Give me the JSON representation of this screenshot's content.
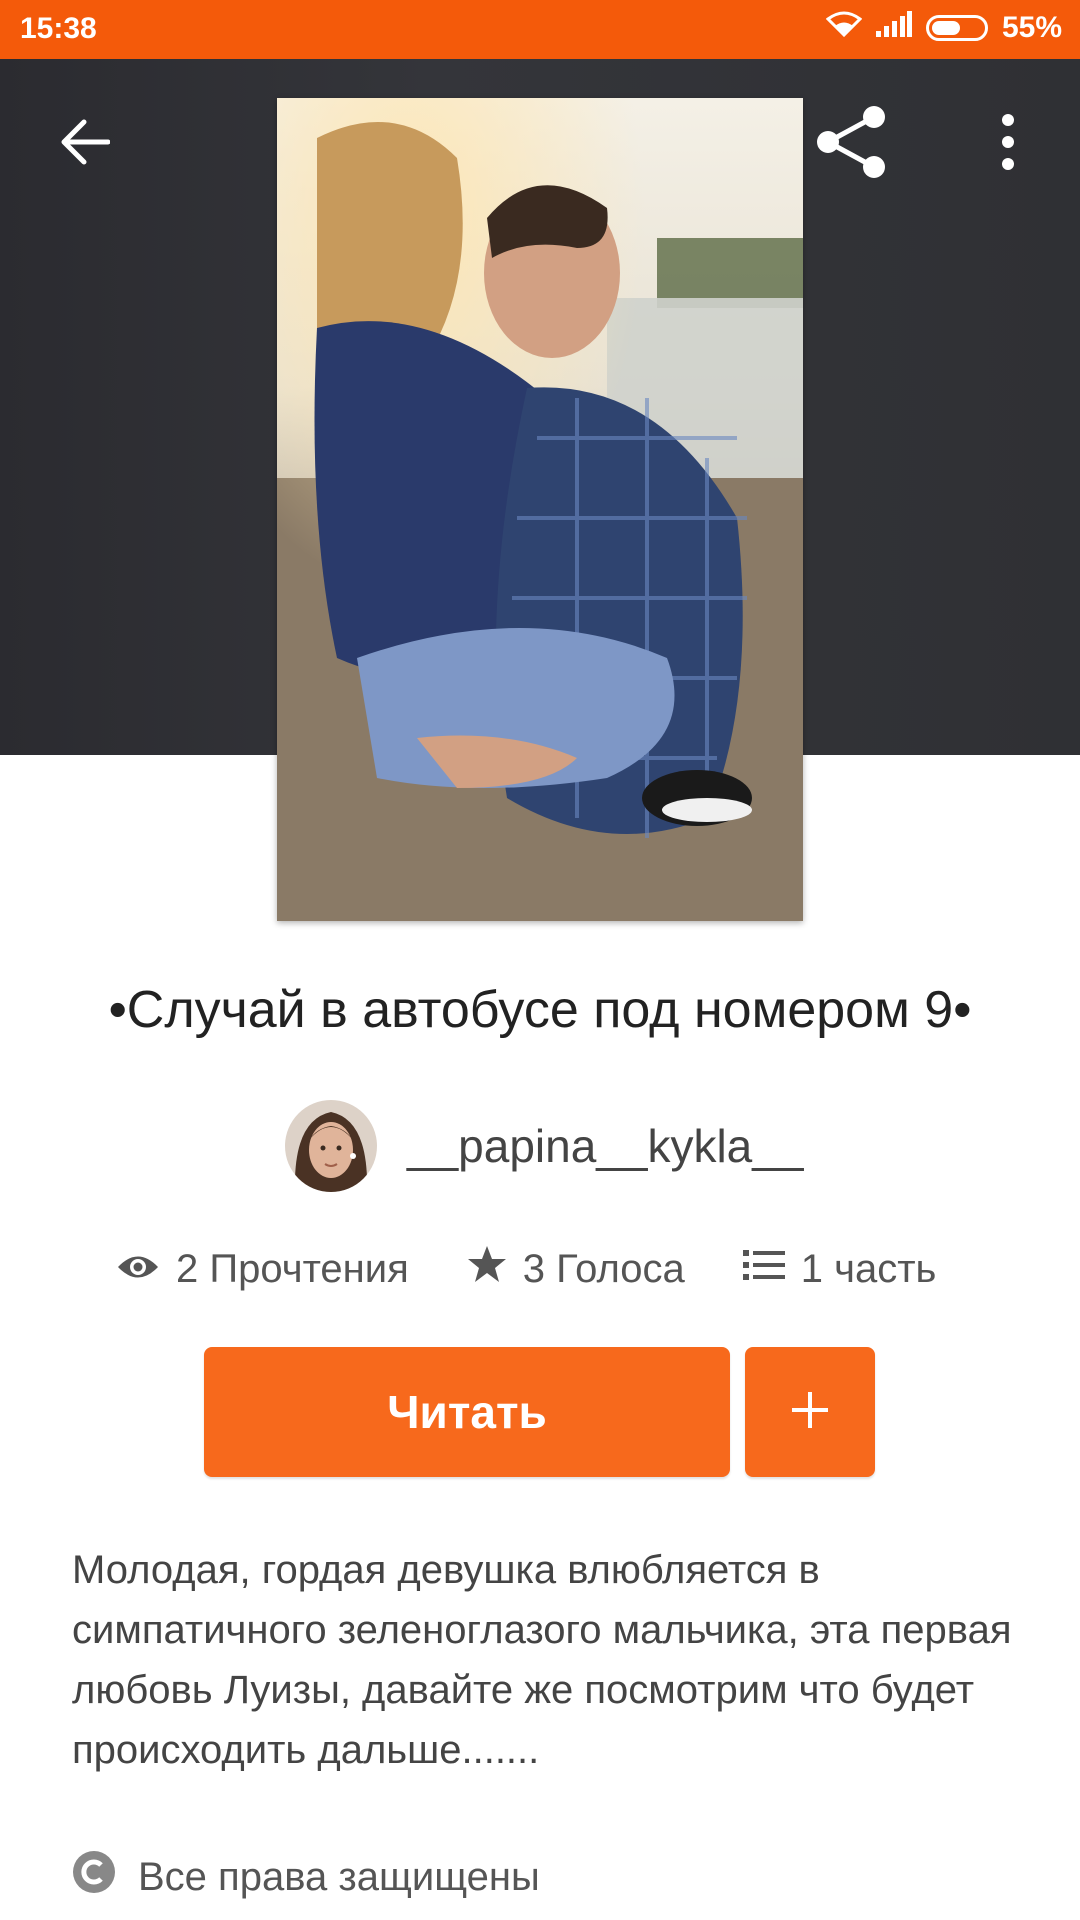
{
  "status_bar": {
    "time": "15:38",
    "battery": "55%",
    "battery_level": 0.55,
    "icons": [
      "wifi-icon",
      "signal-icon",
      "battery-icon"
    ]
  },
  "toolbar": {
    "back_icon": "arrow-left-icon",
    "share_icon": "share-icon",
    "more_icon": "more-vertical-icon"
  },
  "story": {
    "title": "•Случай в автобусе под номером 9•",
    "author": "__papina__kykla__",
    "stats": {
      "reads": "2 Прочтения",
      "votes": "3 Голоса",
      "parts": "1 часть"
    },
    "read_button": "Читать",
    "add_button": "+",
    "description": "Молодая, гордая девушка влюбляется в симпатичного зеленоглазого мальчика, эта первая любовь Луизы, давайте же посмотрим что будет происходить дальше.......",
    "rights": "Все права защищены"
  },
  "colors": {
    "accent": "#f7691c",
    "status_bar": "#f45a0a",
    "header_bg": "#2f3034"
  }
}
